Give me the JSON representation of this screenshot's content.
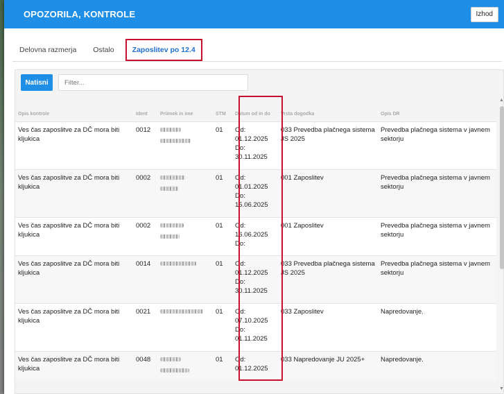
{
  "dialog": {
    "title": "OPOZORILA, KONTROLE",
    "exit_label": "Izhod"
  },
  "tabs": [
    {
      "label": "Delovna razmerja",
      "active": false
    },
    {
      "label": "Ostalo",
      "active": false
    },
    {
      "label": "Zaposlitev po 12.4",
      "active": true
    }
  ],
  "toolbar": {
    "print_label": "Natisni",
    "filter_placeholder": "Filter..."
  },
  "table": {
    "headers": [
      "Opis kontrole",
      "Ident",
      "Priimek in ime",
      "STM",
      "Datum od in do",
      "Vrsta dogodka",
      "Opis DR"
    ],
    "rows": [
      {
        "opis": "Ves čas zaposlitve za DČ mora biti kljukica",
        "ident": "0012",
        "stm": "01",
        "od": "Od:",
        "od_date": "01.12.2025",
        "do": "Do:",
        "do_date": "30.11.2025",
        "vrsta": "033 Prevedba plačnega sistema JS 2025",
        "opis_dr": "Prevedba plačnega sistema v javnem sektorju"
      },
      {
        "opis": "Ves čas zaposlitve za DČ mora biti kljukica",
        "ident": "0002",
        "stm": "01",
        "od": "Od:",
        "od_date": "01.01.2025",
        "do": "Do:",
        "do_date": "15.06.2025",
        "vrsta": "001 Zaposlitev",
        "opis_dr": "Prevedba plačnega sistema v javnem sektorju"
      },
      {
        "opis": "Ves čas zaposlitve za DČ mora biti kljukica",
        "ident": "0002",
        "stm": "01",
        "od": "Od:",
        "od_date": "16.06.2025",
        "do": "Do:",
        "do_date": "",
        "vrsta": "001 Zaposlitev",
        "opis_dr": "Prevedba plačnega sistema v javnem sektorju"
      },
      {
        "opis": "Ves čas zaposlitve za DČ mora biti kljukica",
        "ident": "0014",
        "stm": "01",
        "od": "Od:",
        "od_date": "01.12.2025",
        "do": "Do:",
        "do_date": "30.11.2025",
        "vrsta": "033 Prevedba plačnega sistema JS 2025",
        "opis_dr": "Prevedba plačnega sistema v javnem sektorju"
      },
      {
        "opis": "Ves čas zaposlitve za DČ mora biti kljukica",
        "ident": "0021",
        "stm": "01",
        "od": "Od:",
        "od_date": "07.10.2025",
        "do": "Do:",
        "do_date": "01.11.2025",
        "vrsta": "033 Zaposlitev",
        "opis_dr": "Napredovanje."
      },
      {
        "opis": "Ves čas zaposlitve za DČ mora biti kljukica",
        "ident": "0048",
        "stm": "01",
        "od": "Od:",
        "od_date": "01.12.2025",
        "do": "",
        "do_date": "",
        "vrsta": "033 Napredovanje JU 2025+",
        "opis_dr": "Napredovanje."
      }
    ]
  },
  "colors": {
    "header_bg": "#1f8ee6",
    "highlight": "#c8102e",
    "tab_active": "#1f6fd0"
  }
}
